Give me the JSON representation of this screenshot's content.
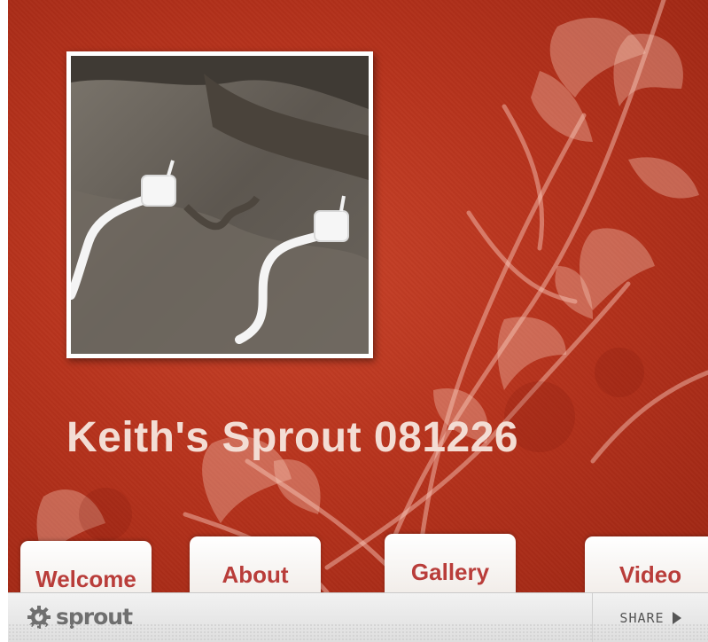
{
  "widget": {
    "title": "Keith's Sprout 081226",
    "photo_icon": "photo-image",
    "floral_icon": "floral-decoration"
  },
  "tabs": [
    {
      "label": "Welcome"
    },
    {
      "label": "About"
    },
    {
      "label": "Gallery"
    },
    {
      "label": "Video"
    }
  ],
  "footer": {
    "brand_name": "sprout",
    "brand_icon": "gear-sprout-logo",
    "share_label": "SHARE",
    "share_icon": "play-arrow-icon"
  },
  "colors": {
    "background": "#b7331d",
    "tab_text": "#b93d3a",
    "title_text": "#f3ddd4",
    "footer": "#e8e8e8"
  }
}
